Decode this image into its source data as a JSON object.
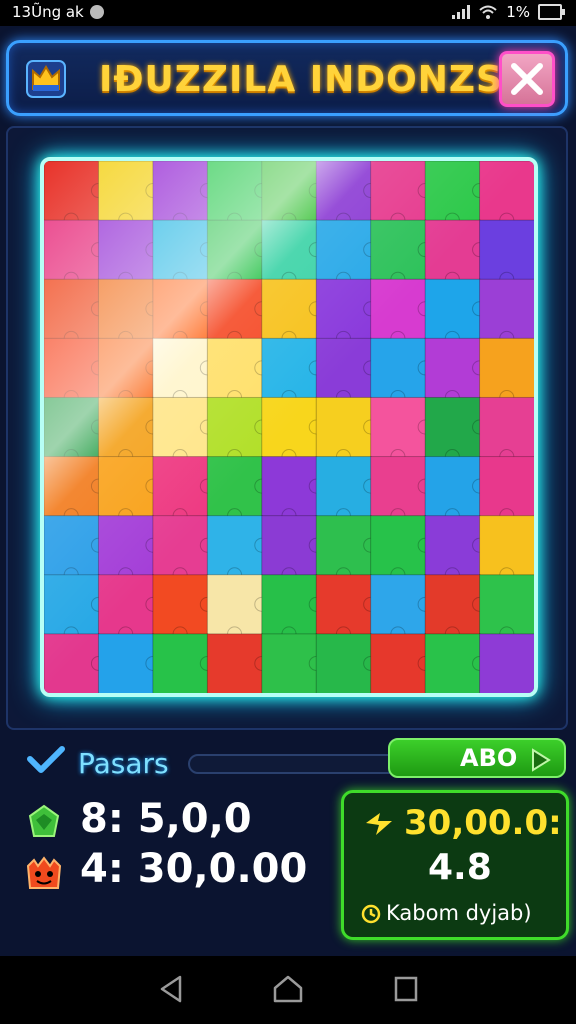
{
  "status_bar": {
    "left_text": "13Ũng ak",
    "battery_text": "1%"
  },
  "header": {
    "title": "IĐUZZILA INDONZSIA",
    "logo_icon": "crown-puzzle-icon",
    "close_icon": "close-icon"
  },
  "board": {
    "rows": 9,
    "cols": 9,
    "colors": [
      [
        "#e8332a",
        "#f5d52a",
        "#9932d6",
        "#26c94c",
        "#3bc23a",
        "#8b3bd4",
        "#e63a8e",
        "#2ec94b",
        "#e9388c"
      ],
      [
        "#e93b85",
        "#9b3ed8",
        "#27b8e4",
        "#28c249",
        "#3ad3a6",
        "#27a8e8",
        "#2ec25b",
        "#e43c93",
        "#6b3fe0"
      ],
      [
        "#f04a20",
        "#f2711e",
        "#ff6a1f",
        "#f54a26",
        "#f7c21c",
        "#8a3adc",
        "#d73bd0",
        "#1ea5ea",
        "#9b3fd6"
      ],
      [
        "#f8451f",
        "#fb6c1e",
        "#fff5cc",
        "#ffe06a",
        "#27b5e8",
        "#8a3cd8",
        "#26a4ea",
        "#b23cd6",
        "#f6a21e"
      ],
      [
        "#2aa04a",
        "#f4a21c",
        "#ffe68a",
        "#b2e02a",
        "#f8d61c",
        "#f6cf1f",
        "#f4549d",
        "#22a84a",
        "#e63f93"
      ],
      [
        "#f27a1b",
        "#f9a21a",
        "#ee3a82",
        "#31c24a",
        "#8d39d8",
        "#27aee2",
        "#e93f8f",
        "#24a3e8",
        "#e8388c"
      ],
      [
        "#2a9ee8",
        "#a43fd8",
        "#e63d92",
        "#2fb3e8",
        "#8b3bd4",
        "#2ebf4e",
        "#27c24a",
        "#8a3cd8",
        "#f7c11e"
      ],
      [
        "#27a8e6",
        "#e6388c",
        "#f24a22",
        "#f7e6a8",
        "#27c049",
        "#e63a2c",
        "#2ea6ea",
        "#e33a2a",
        "#2ec24b"
      ],
      [
        "#e3388e",
        "#24a2ea",
        "#27c249",
        "#e63a2c",
        "#2ec04a",
        "#27b84a",
        "#e6382c",
        "#29c24a",
        "#8e3bd6"
      ]
    ]
  },
  "progress": {
    "label": "Pasars",
    "check_icon": "check-icon",
    "value": 0,
    "button_label": "ABO",
    "button_icon": "play-icon"
  },
  "stats": [
    {
      "icon": "green-gem-icon",
      "text": "8: 5,0,0"
    },
    {
      "icon": "red-monster-icon",
      "text": "4: 30,0.00"
    }
  ],
  "reward": {
    "bolt_icon": "bolt-icon",
    "amount": "30,00.0:",
    "value": "4.8",
    "clock_icon": "clock-icon",
    "caption": "Kabom dyjab)"
  },
  "nav": {
    "back_icon": "back-icon",
    "home_icon": "home-icon",
    "recents_icon": "recents-icon"
  }
}
